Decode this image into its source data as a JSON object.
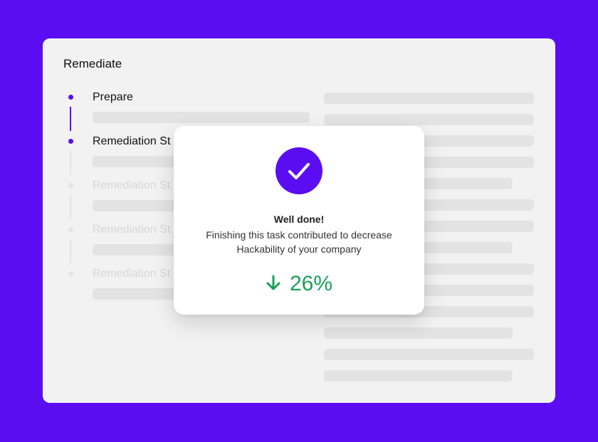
{
  "panel": {
    "title": "Remediate"
  },
  "steps": [
    {
      "label": "Prepare",
      "state": "active"
    },
    {
      "label": "Remediation St",
      "state": "active"
    },
    {
      "label": "Remediation St",
      "state": "inactive"
    },
    {
      "label": "Remediation St",
      "state": "inactive"
    },
    {
      "label": "Remediation St",
      "state": "inactive"
    }
  ],
  "modal": {
    "icon": "checkmark-icon",
    "title": "Well done!",
    "message": "Finishing this task contributed to decrease Hackability of your company",
    "delta": {
      "icon": "arrow-down-icon",
      "value": "26%"
    }
  },
  "colors": {
    "background": "#5b0df2",
    "accent": "#5b0df2",
    "panel": "#f2f2f2",
    "skeleton": "#e3e3e3",
    "inactive": "#d6d6d6",
    "success": "#1aa05a"
  }
}
